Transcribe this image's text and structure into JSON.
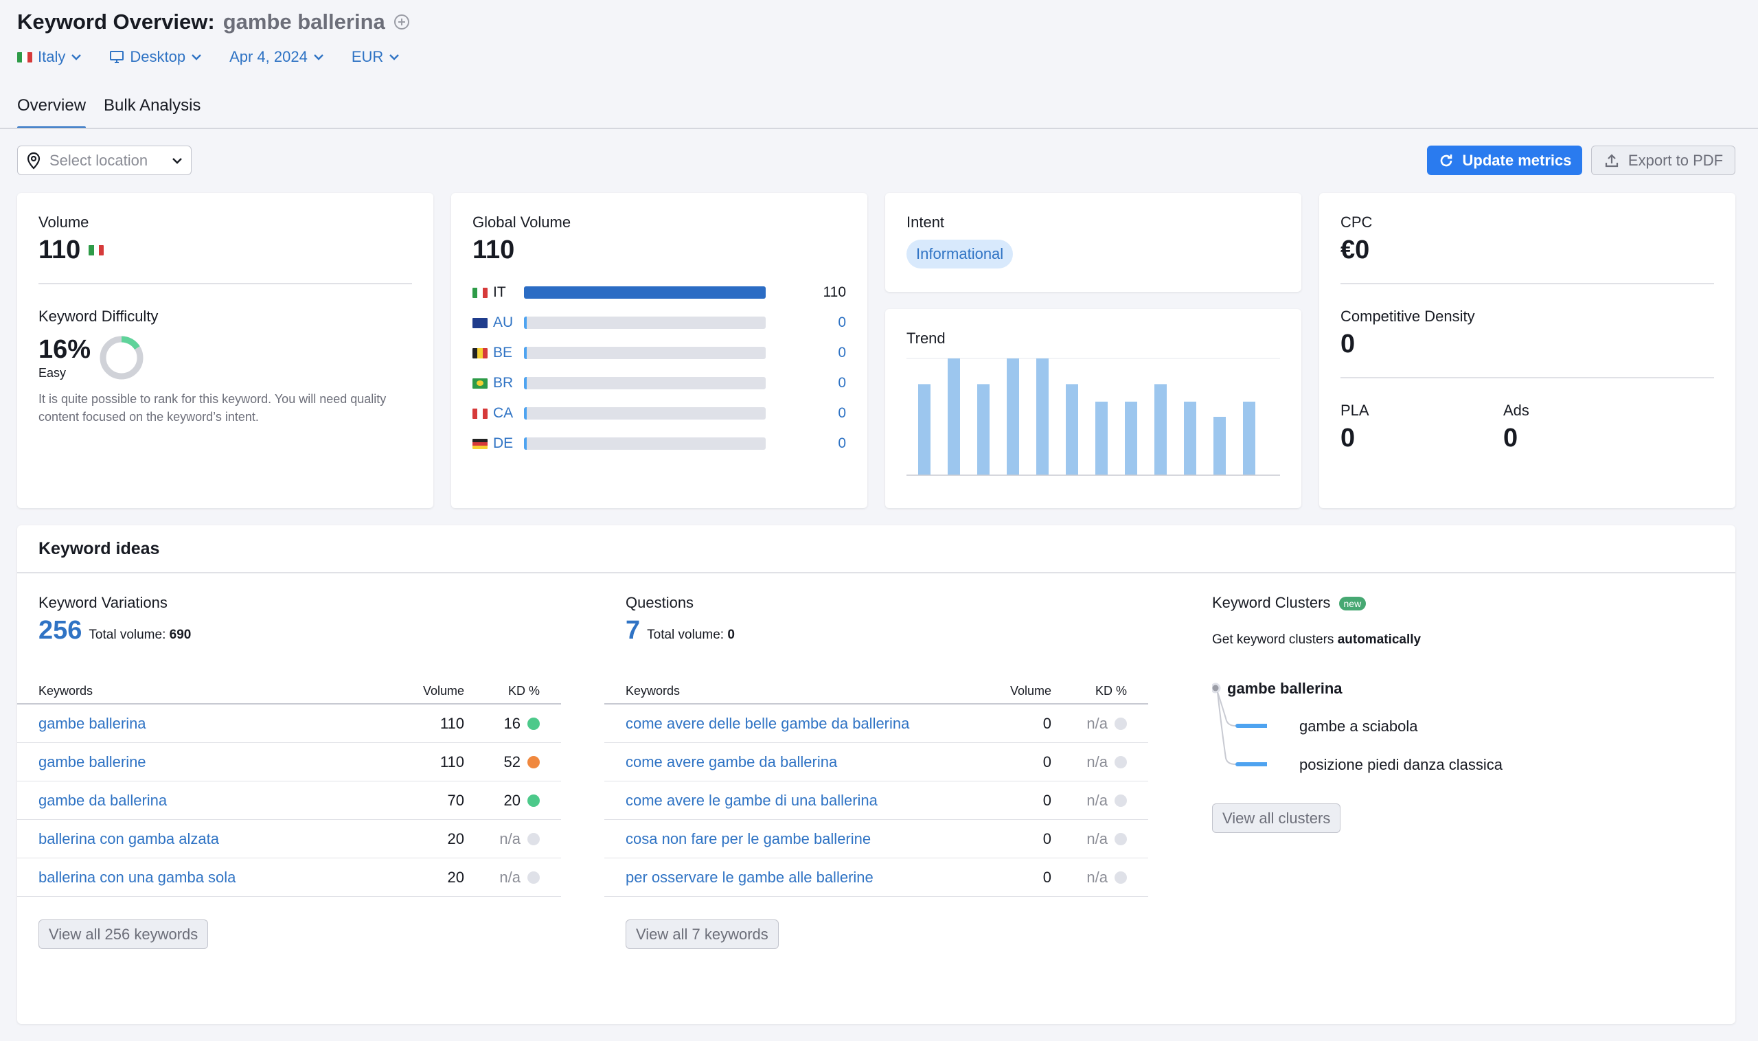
{
  "header": {
    "title": "Keyword Overview:",
    "keyword": "gambe ballerina"
  },
  "filters": {
    "country": "Italy",
    "device": "Desktop",
    "date": "Apr 4, 2024",
    "currency": "EUR"
  },
  "tabs": [
    {
      "label": "Overview",
      "active": true
    },
    {
      "label": "Bulk Analysis",
      "active": false
    }
  ],
  "toolbar": {
    "location_placeholder": "Select location",
    "update_label": "Update metrics",
    "export_label": "Export to PDF"
  },
  "volume": {
    "label": "Volume",
    "value": "110"
  },
  "keyword_difficulty": {
    "label": "Keyword Difficulty",
    "value": "16%",
    "percent": 16,
    "level": "Easy",
    "description": "It is quite possible to rank for this keyword. You will need quality content focused on the keyword’s intent."
  },
  "global_volume": {
    "label": "Global Volume",
    "value": "110",
    "countries": [
      {
        "code": "IT",
        "value": "110",
        "fraction": 1.0
      },
      {
        "code": "AU",
        "value": "0",
        "fraction": 0
      },
      {
        "code": "BE",
        "value": "0",
        "fraction": 0
      },
      {
        "code": "BR",
        "value": "0",
        "fraction": 0
      },
      {
        "code": "CA",
        "value": "0",
        "fraction": 0
      },
      {
        "code": "DE",
        "value": "0",
        "fraction": 0
      }
    ]
  },
  "intent": {
    "label": "Intent",
    "value": "Informational"
  },
  "trend": {
    "label": "Trend",
    "values": [
      0.78,
      1.0,
      0.78,
      1.0,
      1.0,
      0.78,
      0.63,
      0.63,
      0.78,
      0.63,
      0.5,
      0.63
    ]
  },
  "cpc": {
    "label": "CPC",
    "value": "€0",
    "competitive_density_label": "Competitive Density",
    "competitive_density_value": "0",
    "pla_label": "PLA",
    "pla_value": "0",
    "ads_label": "Ads",
    "ads_value": "0"
  },
  "keyword_ideas": {
    "title": "Keyword ideas",
    "variations": {
      "title": "Keyword Variations",
      "count": "256",
      "total_volume_label": "Total volume:",
      "total_volume": "690",
      "col_keywords": "Keywords",
      "col_volume": "Volume",
      "col_kd": "KD %",
      "rows": [
        {
          "keyword": "gambe ballerina",
          "volume": "110",
          "kd": "16",
          "kd_color": "#4cc98a"
        },
        {
          "keyword": "gambe ballerine",
          "volume": "110",
          "kd": "52",
          "kd_color": "#f0883e"
        },
        {
          "keyword": "gambe da ballerina",
          "volume": "70",
          "kd": "20",
          "kd_color": "#4cc98a"
        },
        {
          "keyword": "ballerina con gamba alzata",
          "volume": "20",
          "kd": "n/a",
          "kd_color": "#dfe1e8"
        },
        {
          "keyword": "ballerina con una gamba sola",
          "volume": "20",
          "kd": "n/a",
          "kd_color": "#dfe1e8"
        }
      ],
      "view_all": "View all 256 keywords"
    },
    "questions": {
      "title": "Questions",
      "count": "7",
      "total_volume_label": "Total volume:",
      "total_volume": "0",
      "col_keywords": "Keywords",
      "col_volume": "Volume",
      "col_kd": "KD %",
      "rows": [
        {
          "keyword": "come avere delle belle gambe da ballerina",
          "volume": "0",
          "kd": "n/a",
          "kd_color": "#dfe1e8"
        },
        {
          "keyword": "come avere gambe da ballerina",
          "volume": "0",
          "kd": "n/a",
          "kd_color": "#dfe1e8"
        },
        {
          "keyword": "come avere le gambe di una ballerina",
          "volume": "0",
          "kd": "n/a",
          "kd_color": "#dfe1e8"
        },
        {
          "keyword": "cosa non fare per le gambe ballerine",
          "volume": "0",
          "kd": "n/a",
          "kd_color": "#dfe1e8"
        },
        {
          "keyword": "per osservare le gambe alle ballerine",
          "volume": "0",
          "kd": "n/a",
          "kd_color": "#dfe1e8"
        }
      ],
      "view_all": "View all 7 keywords"
    },
    "clusters": {
      "title": "Keyword Clusters",
      "badge": "new",
      "subtitle_prefix": "Get keyword clusters",
      "subtitle_bold": "automatically",
      "root": "gambe ballerina",
      "children": [
        "gambe a sciabola",
        "posizione piedi danza classica"
      ],
      "view_all": "View all clusters"
    }
  },
  "colors": {
    "accent": "#2a7bef",
    "link": "#2f73c4",
    "bar": "#2b6cc4",
    "trend_bar": "#9cc6ee"
  }
}
